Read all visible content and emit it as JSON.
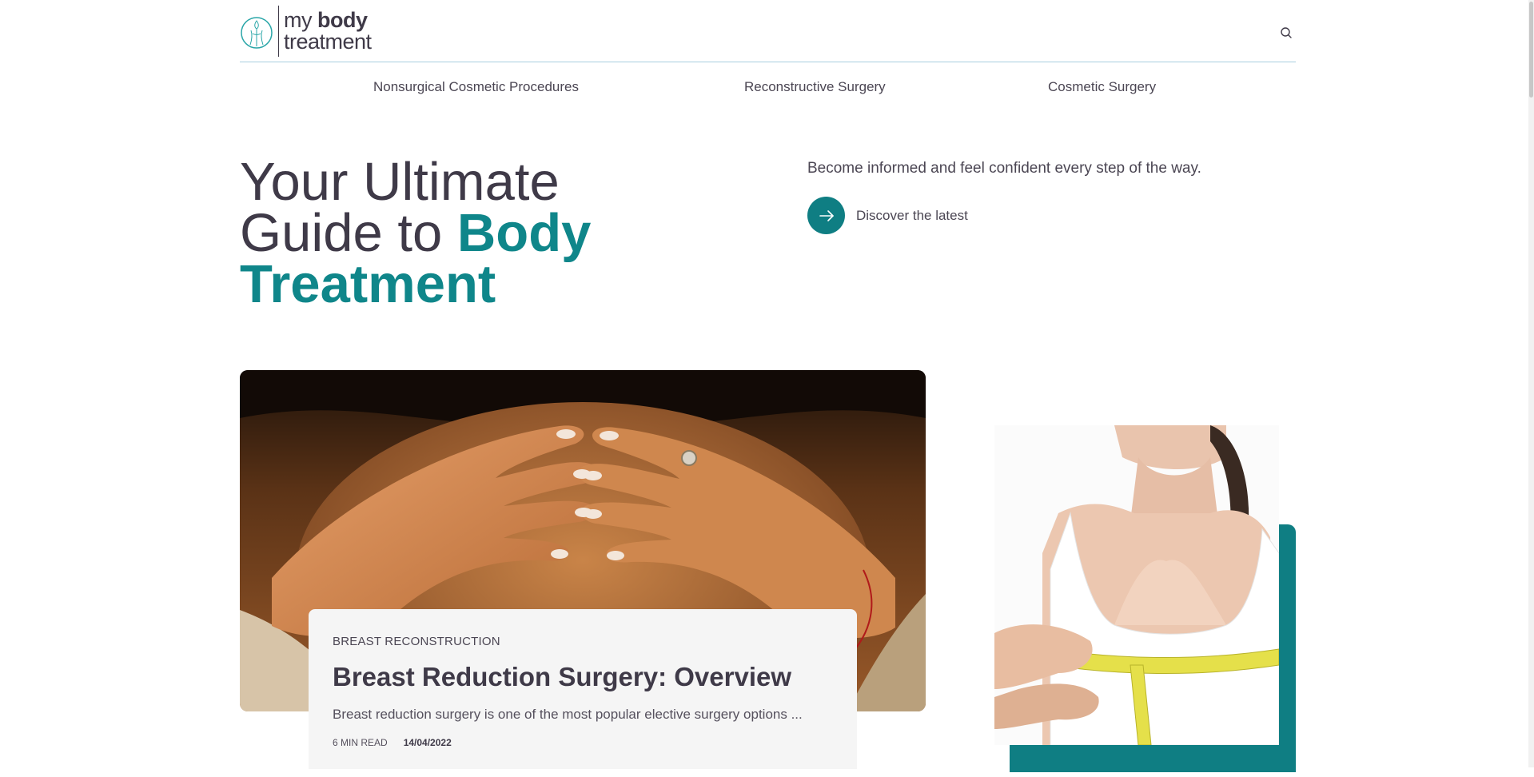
{
  "logo": {
    "line1_light": "my ",
    "line1_bold": "body",
    "line2": "treatment"
  },
  "header": {
    "search_icon": "search-icon"
  },
  "nav": {
    "items": [
      {
        "label": "Nonsurgical Cosmetic Procedures"
      },
      {
        "label": "Reconstructive Surgery"
      },
      {
        "label": "Cosmetic Surgery"
      }
    ]
  },
  "hero": {
    "title_line1": "Your Ultimate",
    "title_line2_plain": "Guide to ",
    "title_line2_accent": "Body",
    "title_line3_accent": "Treatment",
    "subtitle": "Become informed and feel confident every step of the way.",
    "cta_label": "Discover the latest",
    "cta_icon": "arrow-right-icon"
  },
  "featured": {
    "category": "BREAST RECONSTRUCTION",
    "title": "Breast Reduction Surgery: Overview",
    "excerpt": "Breast reduction surgery is one of the most popular elective surgery options ...",
    "read_time": "6 MIN READ",
    "date": "14/04/2022"
  },
  "colors": {
    "accent": "#0f868a",
    "text": "#3f3a48",
    "rule": "#a9cfe0"
  }
}
